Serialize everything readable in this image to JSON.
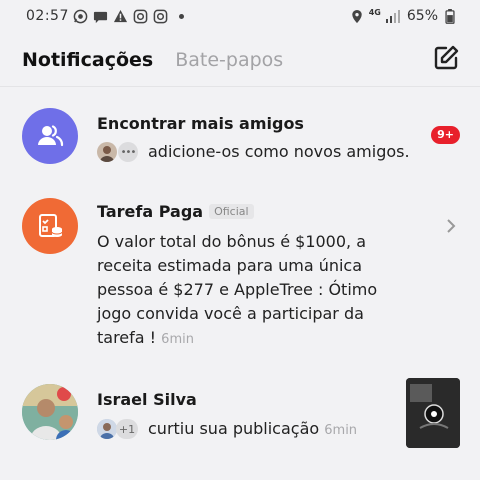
{
  "status_bar": {
    "time": "02:57",
    "net_type": "4G",
    "battery": "65%",
    "icons": [
      "whatsapp-icon",
      "chat-bubble-icon",
      "alert-icon",
      "instagram-icon",
      "instagram-icon",
      "dot-icon",
      "location-icon",
      "signal-icon",
      "battery-icon"
    ]
  },
  "tabs": {
    "notifications": "Notificações",
    "chats": "Bate-papos"
  },
  "notifications": [
    {
      "title": "Encontrar mais amigos",
      "text": "adicione-os como novos amigos.",
      "badge": "9+",
      "avatar_color": "#6f6fe8",
      "icon": "friends-icon"
    },
    {
      "title": "Tarefa Paga",
      "tag": "Oficial",
      "lines": [
        "O valor total do bônus é $1000, a",
        "receita estimada para uma única",
        "pessoa é $277 e AppleTree : Ótimo",
        "jogo convida você a participar da",
        "tarefa ! "
      ],
      "time": "6min",
      "avatar_color": "#f06a35",
      "icon": "task-icon"
    },
    {
      "title": "Israel Silva",
      "extra_count": "+1",
      "text": "curtiu sua publicação",
      "time": "6min",
      "icon": "user-photo"
    }
  ]
}
